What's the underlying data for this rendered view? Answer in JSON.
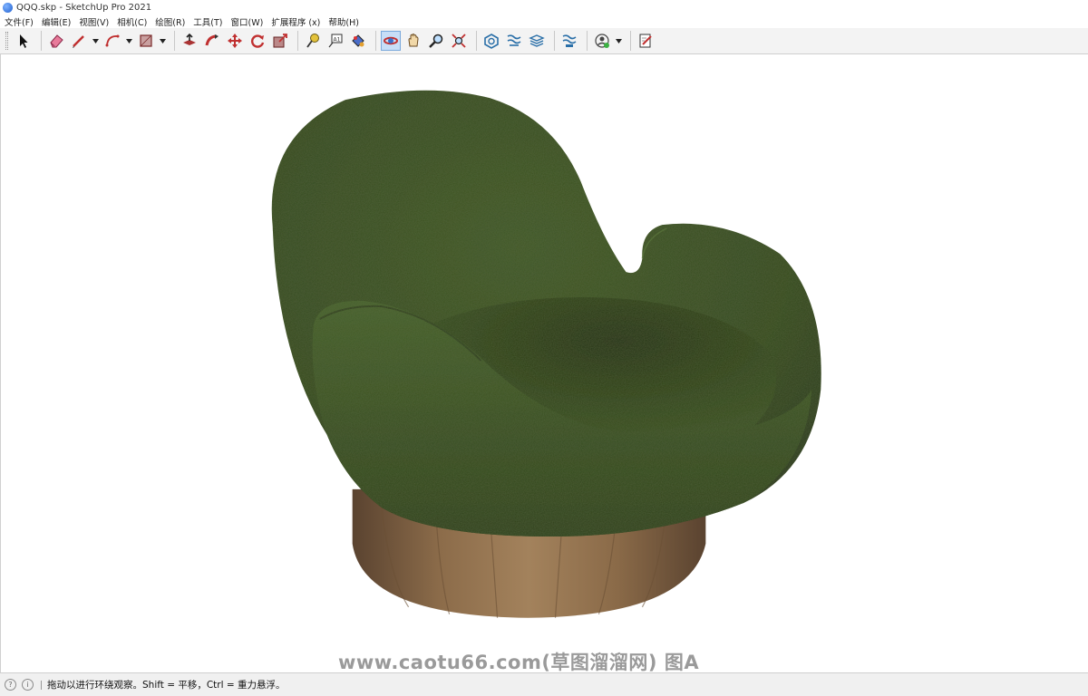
{
  "window": {
    "title": "QQQ.skp - SketchUp Pro 2021"
  },
  "menubar": {
    "items": [
      {
        "label": "文件(F)"
      },
      {
        "label": "编辑(E)"
      },
      {
        "label": "视图(V)"
      },
      {
        "label": "相机(C)"
      },
      {
        "label": "绘图(R)"
      },
      {
        "label": "工具(T)"
      },
      {
        "label": "窗口(W)"
      },
      {
        "label": "扩展程序 (x)"
      },
      {
        "label": "帮助(H)"
      }
    ]
  },
  "toolbar": {
    "tools": [
      {
        "icon": "select-arrow-icon"
      },
      {
        "icon": "eraser-icon"
      },
      {
        "icon": "pencil-line-icon",
        "dropdown": true
      },
      {
        "icon": "arc-icon",
        "dropdown": true
      },
      {
        "icon": "rectangle-icon",
        "dropdown": true
      },
      {
        "icon": "push-pull-icon"
      },
      {
        "icon": "follow-me-icon"
      },
      {
        "icon": "move-icon"
      },
      {
        "icon": "rotate-icon"
      },
      {
        "icon": "scale-icon"
      },
      {
        "icon": "tape-measure-icon"
      },
      {
        "icon": "text-tool-icon"
      },
      {
        "icon": "paint-bucket-icon"
      },
      {
        "icon": "orbit-icon",
        "active": true
      },
      {
        "icon": "pan-icon"
      },
      {
        "icon": "zoom-icon"
      },
      {
        "icon": "zoom-extents-icon"
      },
      {
        "icon": "warehouse-icon"
      },
      {
        "icon": "extension-warehouse-icon"
      },
      {
        "icon": "layout-send-icon"
      },
      {
        "icon": "extension-manager-icon"
      },
      {
        "icon": "profile-icon",
        "dropdown": true
      },
      {
        "icon": "sketch-notes-icon"
      }
    ]
  },
  "viewport": {
    "model": "green upholstered swivel armchair on a round wooden base",
    "watermark": "www.caotu66.com(草图溜溜网) 图A",
    "colors": {
      "fabric": "#34491f",
      "fabric_dark": "#1f2d12",
      "wood": "#8a6a48",
      "wood_dark": "#5a4330"
    }
  },
  "statusbar": {
    "icons": [
      "geolocation-icon",
      "credits-icon"
    ],
    "message": "拖动以进行环绕观察。Shift = 平移，Ctrl = 重力悬浮。"
  }
}
